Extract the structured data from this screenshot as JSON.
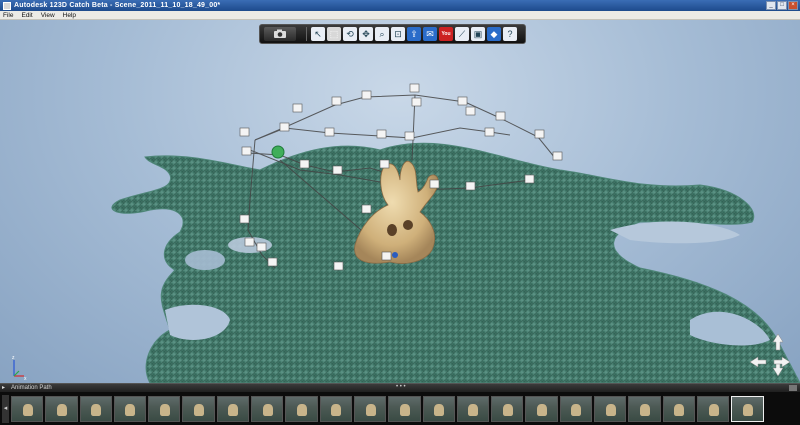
{
  "window": {
    "title": "Autodesk 123D Catch Beta - Scene_2011_11_10_18_49_00*",
    "controls": [
      "minimize",
      "maximize",
      "close"
    ]
  },
  "menu": {
    "items": [
      "File",
      "Edit",
      "View",
      "Help"
    ]
  },
  "toolbar": {
    "camera_icon": "camera-icon",
    "tools": [
      {
        "name": "select-icon",
        "glyph": "↖",
        "style": "light"
      },
      {
        "name": "select-region-icon",
        "glyph": "⬚",
        "style": "sel"
      },
      {
        "name": "orbit-icon",
        "glyph": "⟲",
        "style": "light"
      },
      {
        "name": "pan-icon",
        "glyph": "✥",
        "style": "light"
      },
      {
        "name": "zoom-icon",
        "glyph": "⌕",
        "style": "light"
      },
      {
        "name": "fit-icon",
        "glyph": "⊡",
        "style": "light"
      },
      {
        "name": "share-icon",
        "glyph": "⇪",
        "style": "blue"
      },
      {
        "name": "email-icon",
        "glyph": "✉",
        "style": "blue"
      },
      {
        "name": "youtube-icon",
        "glyph": "You",
        "style": "red"
      },
      {
        "name": "measure-icon",
        "glyph": "⟋",
        "style": "light"
      },
      {
        "name": "pin-icon",
        "glyph": "▣",
        "style": "light"
      },
      {
        "name": "export-icon",
        "glyph": "◆",
        "style": "blue"
      },
      {
        "name": "help-icon",
        "glyph": "?",
        "style": "light"
      }
    ]
  },
  "animation_path": {
    "label": "Animation Path",
    "handle": "• • •"
  },
  "filmstrip": {
    "left_arrow": "◂",
    "thumbnail_count": 22,
    "selected_index": 21
  },
  "colors": {
    "sky": "#a5bcd5",
    "ground": "#3d7465",
    "camera_path": "#444444"
  }
}
